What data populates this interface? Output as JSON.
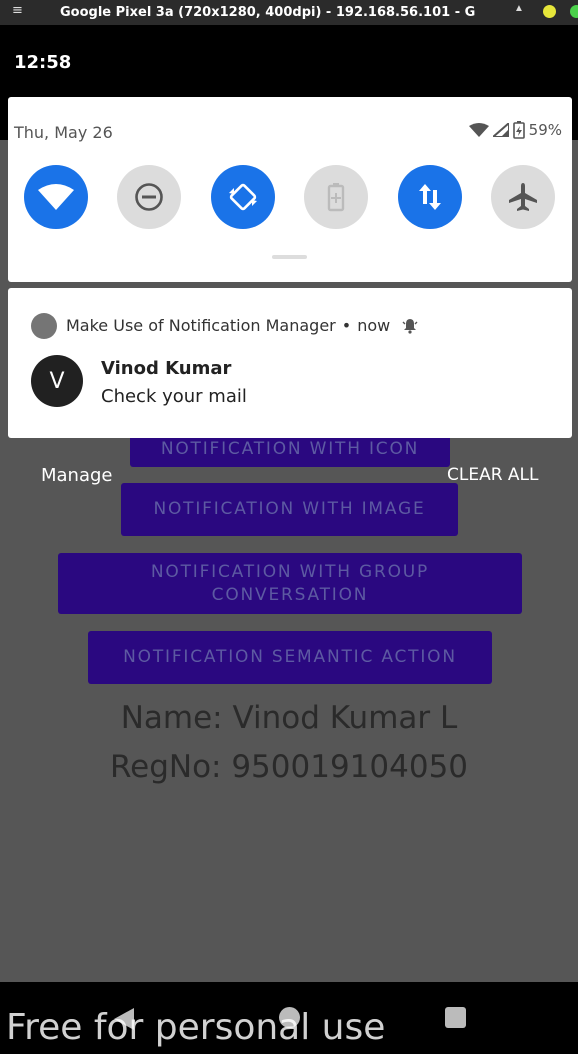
{
  "emulator": {
    "menu_glyph": "≡",
    "title": "Google Pixel 3a (720x1280, 400dpi) - 192.168.56.101 - G",
    "caret": "▲"
  },
  "status_bar": {
    "time": "12:58"
  },
  "quick_settings": {
    "date": "Thu, May 26",
    "battery": "59%",
    "tiles": [
      {
        "icon": "wifi-icon",
        "state": "on"
      },
      {
        "icon": "do-not-disturb-icon",
        "state": "off"
      },
      {
        "icon": "auto-rotate-icon",
        "state": "on"
      },
      {
        "icon": "battery-saver-icon",
        "state": "off"
      },
      {
        "icon": "mobile-data-icon",
        "state": "on"
      },
      {
        "icon": "airplane-mode-icon",
        "state": "off"
      }
    ]
  },
  "notification": {
    "app_name": "Make Use of Notification Manager",
    "separator": "•",
    "time": "now",
    "avatar_letter": "V",
    "title": "Vinod Kumar",
    "text": "Check your mail"
  },
  "shade_actions": {
    "manage": "Manage",
    "clear_all": "CLEAR ALL"
  },
  "app": {
    "buttons": [
      "NOTIFICATION WITH ICON",
      "NOTIFICATION WITH IMAGE",
      "NOTIFICATION WITH GROUP CONVERSATION",
      "NOTIFICATION SEMANTIC ACTION"
    ],
    "name_line": "Name: Vinod Kumar L",
    "reg_line": "RegNo: 950019104050"
  },
  "watermark": "Free for personal use",
  "colors": {
    "accent": "#1a73e8",
    "button_bg": "#2a0880",
    "scrim": "#565656"
  }
}
